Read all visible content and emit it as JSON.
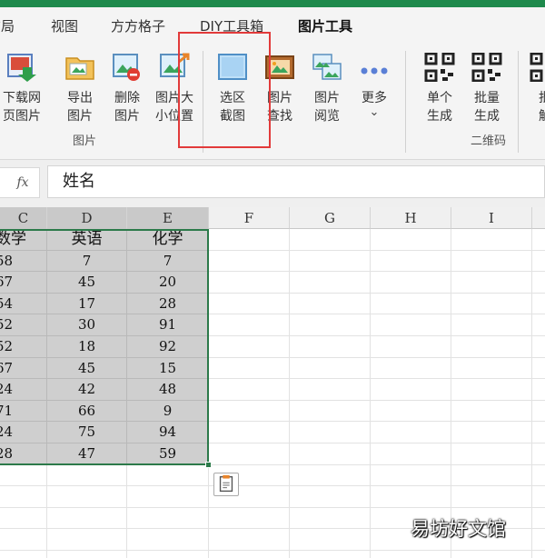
{
  "menu": {
    "tabs": [
      {
        "label": "布局"
      },
      {
        "label": "视图"
      },
      {
        "label": "方方格子"
      },
      {
        "label": "DIY工具箱"
      },
      {
        "label": "图片工具"
      }
    ],
    "active_tab": "图片工具",
    "accent_color": "#1f8a4c"
  },
  "ribbon": {
    "buttons": [
      {
        "label": "下载网\n页图片",
        "icon": "download-image-icon"
      },
      {
        "label": "导出\n图片",
        "icon": "folder-export-icon"
      },
      {
        "label": "删除\n图片",
        "icon": "delete-image-icon"
      },
      {
        "label": "图片大\n小位置",
        "icon": "resize-image-icon"
      },
      {
        "label": "选区\n截图",
        "icon": "selection-screenshot-icon"
      },
      {
        "label": "图片\n查找",
        "icon": "find-image-icon"
      },
      {
        "label": "图片\n阅览",
        "icon": "browse-images-icon"
      },
      {
        "label": "更多",
        "icon": "more-dots-icon"
      },
      {
        "label": "单个\n生成",
        "icon": "qr-single-icon"
      },
      {
        "label": "批量\n生成",
        "icon": "qr-batch-icon"
      },
      {
        "label": "批\n解",
        "icon": "qr-decode-icon"
      }
    ],
    "groups": [
      {
        "label": "图片"
      },
      {
        "label": "二维码"
      }
    ],
    "more_chevron": "⌄",
    "highlight_color": "#e23a3a"
  },
  "formula_bar": {
    "fx_label": "fx",
    "value": "姓名"
  },
  "sheet": {
    "columns": [
      "C",
      "D",
      "E",
      "F",
      "G",
      "H",
      "I"
    ],
    "header_row": [
      "数学",
      "英语",
      "化学"
    ],
    "rows": [
      [
        "58",
        "7",
        "7"
      ],
      [
        "67",
        "45",
        "20"
      ],
      [
        "54",
        "17",
        "28"
      ],
      [
        "52",
        "30",
        "91"
      ],
      [
        "52",
        "18",
        "92"
      ],
      [
        "67",
        "45",
        "15"
      ],
      [
        "24",
        "42",
        "48"
      ],
      [
        "71",
        "66",
        "9"
      ],
      [
        "24",
        "75",
        "94"
      ],
      [
        "28",
        "47",
        "59"
      ]
    ],
    "selection_color": "#2c7a4a"
  },
  "watermark": {
    "text": "易坊好文馆"
  }
}
